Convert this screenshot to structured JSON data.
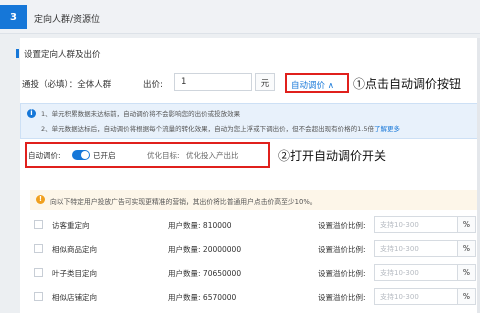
{
  "header": {
    "step_number": "3",
    "title": "定向人群/资源位"
  },
  "section": {
    "title": "设置定向人群及出价"
  },
  "bid_row": {
    "target_label": "通投（必填）：全体人群",
    "bid_label": "出价:",
    "bid_value": "1",
    "unit": "元",
    "auto_adjust_link": "自动调价 ∧"
  },
  "annotations": {
    "first": "①点击自动调价按钮",
    "second": "②打开自动调价开关"
  },
  "info": {
    "icon": "i",
    "line1": "1、单元积累数据未达标前，自动调价将不会影响您的出价或投放效果",
    "line2": "2、单元数据达标后，自动调价将根据每个流量的转化效果，自动为您上浮或下调出价，但不会超出现有价格的1.5倍",
    "more_link": "了解更多"
  },
  "auto_adjust": {
    "label": "自动调价:",
    "status": "已开启",
    "goal_label": "优化目标:",
    "goal_value": "优化投入产出比"
  },
  "warning": {
    "icon": "!",
    "text": "向以下特定用户投放广告可实现更精准的营销，其出价将比普通用户点击价高至少10%。"
  },
  "table": {
    "count_prefix": "用户数量:",
    "premium_label": "设置溢价比例:",
    "placeholder": "支持10-300",
    "percent": "%",
    "rows": [
      {
        "name": "访客重定向",
        "count": "810000"
      },
      {
        "name": "相似商品定向",
        "count": "20000000"
      },
      {
        "name": "叶子类目定向",
        "count": "70650000"
      },
      {
        "name": "相似店铺定向",
        "count": "6570000"
      }
    ]
  },
  "colors": {
    "accent": "#1677d8",
    "highlight": "#e0201c"
  }
}
